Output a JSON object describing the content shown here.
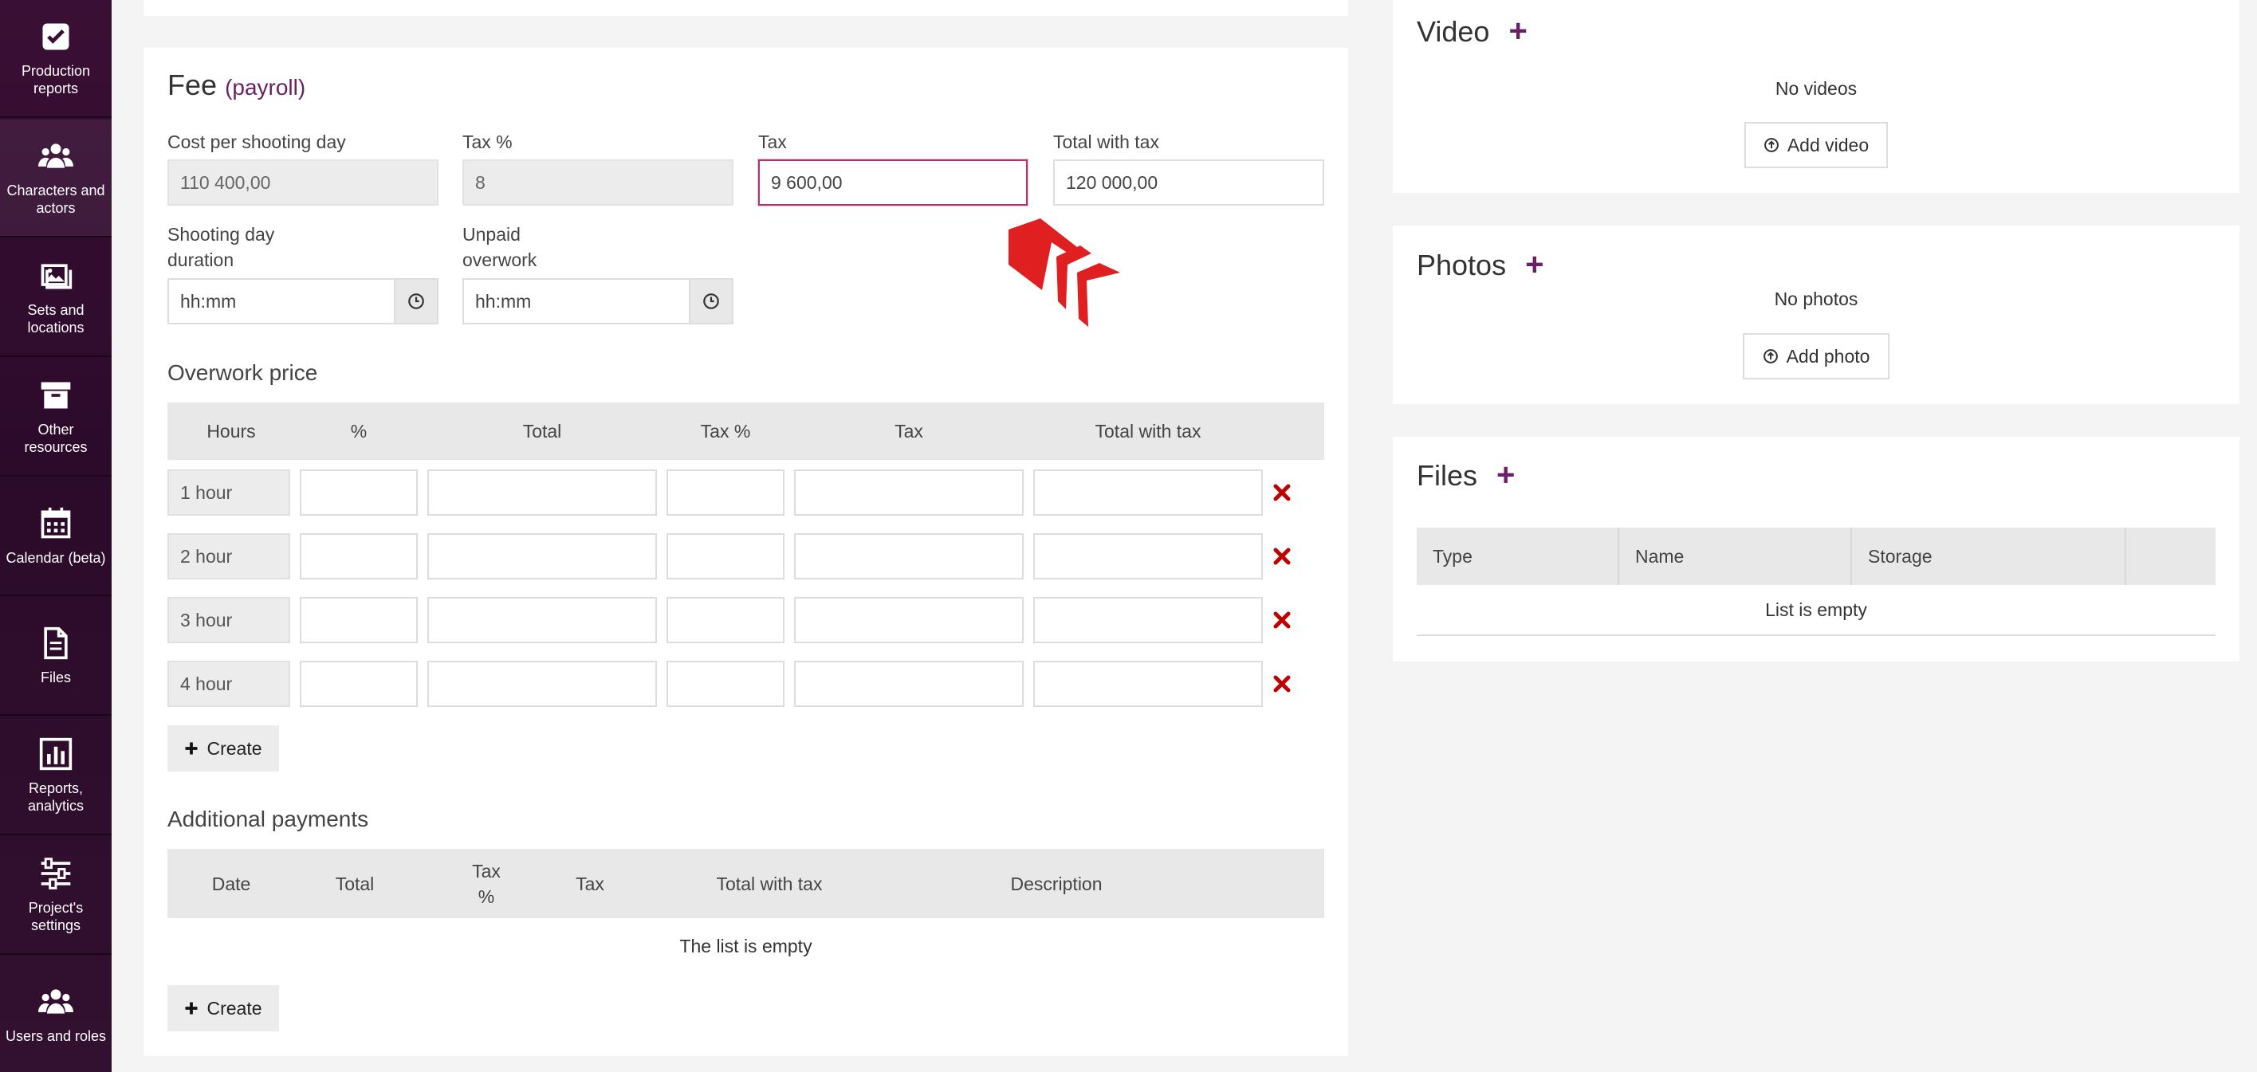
{
  "sidebar": {
    "items": [
      {
        "label": "Production reports",
        "icon": "checkbox-icon"
      },
      {
        "label": "Characters and actors",
        "icon": "users-icon"
      },
      {
        "label": "Sets and locations",
        "icon": "image-icon"
      },
      {
        "label": "Other resources",
        "icon": "archive-box-icon"
      },
      {
        "label": "Calendar (beta)",
        "icon": "calendar-icon"
      },
      {
        "label": "Files",
        "icon": "file-icon"
      },
      {
        "label": "Reports, analytics",
        "icon": "bar-chart-icon"
      },
      {
        "label": "Project's settings",
        "icon": "sliders-icon"
      },
      {
        "label": "Users and roles",
        "icon": "users-icon"
      }
    ]
  },
  "fee": {
    "title": "Fee",
    "subtitle": "(payroll)",
    "cost_label": "Cost per shooting day",
    "cost_value": "110 400,00",
    "taxpct_label": "Tax %",
    "taxpct_value": "8",
    "tax_label": "Tax",
    "tax_value": "9 600,00",
    "total_label": "Total with tax",
    "total_value": "120 000,00",
    "duration_label_1": "Shooting day",
    "duration_label_2": "duration",
    "duration_placeholder": "hh:mm",
    "unpaid_label_1": "Unpaid",
    "unpaid_label_2": "overwork",
    "unpaid_placeholder": "hh:mm"
  },
  "overwork": {
    "title": "Overwork price",
    "columns": [
      "Hours",
      "%",
      "Total",
      "Tax %",
      "Tax",
      "Total with tax"
    ],
    "rows": [
      "1 hour",
      "2 hour",
      "3 hour",
      "4 hour"
    ],
    "create_label": "Create"
  },
  "additional": {
    "title": "Additional payments",
    "col_date": "Date",
    "col_total": "Total",
    "col_taxpct_1": "Tax",
    "col_taxpct_2": "%",
    "col_tax": "Tax",
    "col_total_with_tax": "Total with tax",
    "col_description": "Description",
    "empty": "The list is empty",
    "create_label": "Create"
  },
  "video": {
    "title": "Video",
    "empty": "No videos",
    "add_label": "Add video"
  },
  "photos": {
    "title": "Photos",
    "empty": "No photos",
    "add_label": "Add photo"
  },
  "files": {
    "title": "Files",
    "columns": [
      "Type",
      "Name",
      "Storage"
    ],
    "empty": "List is empty"
  },
  "colors": {
    "accent": "#6b1f66",
    "sidebar": "#2b0a2a",
    "delete": "#c00000",
    "cursor_arrow": "#e02020"
  }
}
